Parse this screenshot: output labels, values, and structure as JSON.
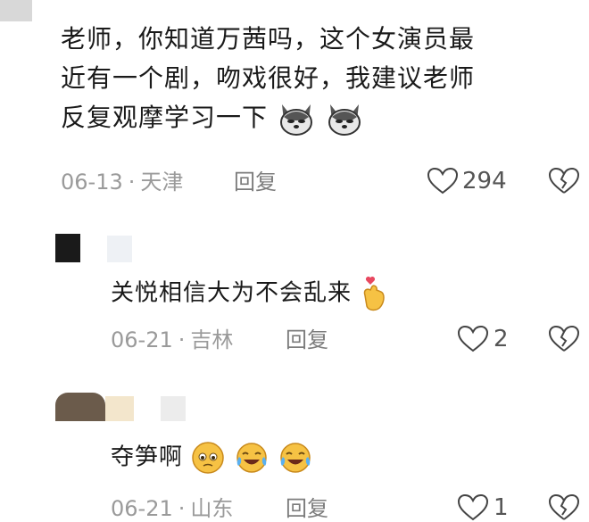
{
  "comments": [
    {
      "text_line1": "老师，你知道万茜吗，这个女演员最",
      "text_line2": "近有一个剧，吻戏很好，我建议老师",
      "text_line3": "反复观摩学习一下",
      "date": "06-13",
      "location": "天津",
      "reply_label": "回复",
      "likes": "294"
    },
    {
      "text": "关悦相信大为不会乱来",
      "date": "06-21",
      "location": "吉林",
      "reply_label": "回复",
      "likes": "2"
    },
    {
      "text": "夺笋啊",
      "date": "06-21",
      "location": "山东",
      "reply_label": "回复",
      "likes": "1"
    }
  ],
  "colors": {
    "text": "#1a1a1a",
    "meta": "#9a9a9a",
    "background": "#ffffff"
  }
}
